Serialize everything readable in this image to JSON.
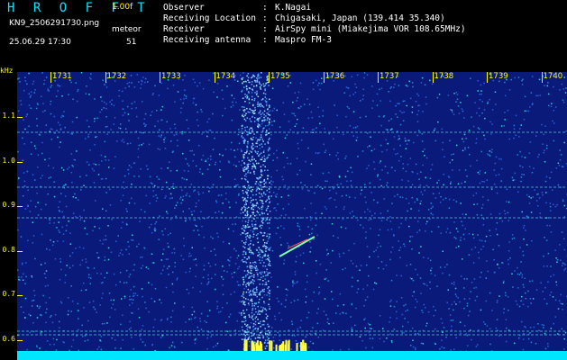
{
  "header": {
    "brand": "H R O F F T",
    "version": "1.00f",
    "filename": "KN9_2506291730.png",
    "mode": "meteor",
    "datetime": "25.06.29 17:30",
    "count": "51"
  },
  "info": {
    "rows": [
      {
        "key": "Observer",
        "sep": ":",
        "value": "K.Nagai"
      },
      {
        "key": "Receiving Location",
        "sep": ":",
        "value": "Chigasaki, Japan (139.414 35.340)"
      },
      {
        "key": "Receiver",
        "sep": ":",
        "value": "AirSpy mini (Miakejima VOR 108.65MHz)"
      },
      {
        "key": "Receiving antenna",
        "sep": ":",
        "value": "Maspro FM-3"
      }
    ]
  },
  "axis": {
    "unit": "kHz",
    "y_ticks": [
      "1.1",
      "1.0",
      "0.9",
      "0.8",
      "0.7",
      "0.6"
    ],
    "x_ticks": [
      "1731",
      "1732",
      "1733",
      "1734",
      "1735",
      "1736",
      "1737",
      "1738",
      "1739",
      "1740"
    ]
  },
  "colors": {
    "background": "#000000",
    "label_yellow": "#ffff00",
    "label_cyan": "#00e6ff",
    "plot_blue": "#0a1a7a"
  }
}
